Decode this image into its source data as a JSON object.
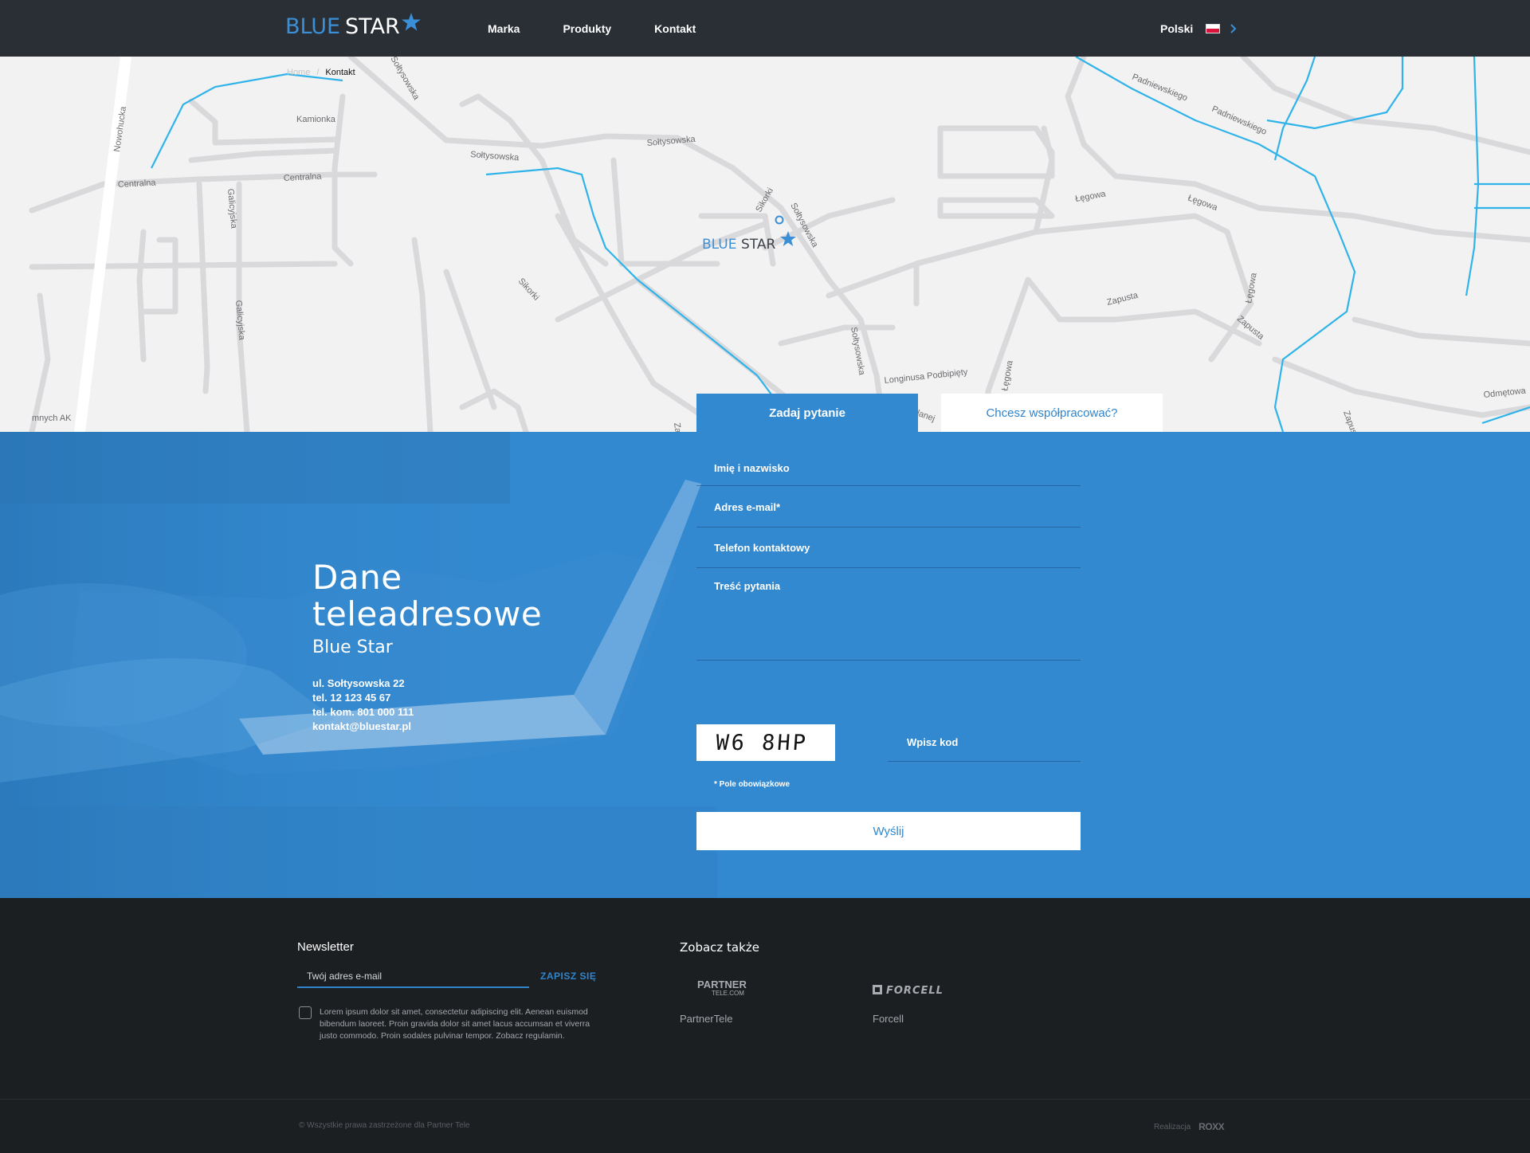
{
  "header": {
    "logo_blue": "BLUE",
    "logo_white": "STAR",
    "nav": [
      {
        "label": "Marka"
      },
      {
        "label": "Produkty"
      },
      {
        "label": "Kontakt"
      }
    ],
    "language": "Polski"
  },
  "breadcrumb": {
    "home": "Home",
    "separator": "/",
    "current": "Kontakt"
  },
  "map": {
    "streets": {
      "nowohucka": "Nowohucka",
      "kamionka": "Kamionka",
      "centralna1": "Centralna",
      "centralna2": "Centralna",
      "soltysowska1": "Sołtysowska",
      "soltysowska2": "Sołtysowska",
      "soltysowska3": "Sołtysowska",
      "soltysowska4": "Sołtysowska",
      "soltysowska5": "Sołtysowska",
      "galicyjska1": "Galicyjska",
      "galicyjska2": "Galicyjska",
      "sikorki1": "Sikorki",
      "sikorki2": "Sikorki",
      "legowa1": "Łęgowa",
      "legowa2": "Łęgowa",
      "legowa3": "Łęgowa",
      "legowa4": "Łęgowa",
      "padniewskiego1": "Padniewskiego",
      "padniewskiego2": "Padniewskiego",
      "zapusta1": "Zapusta",
      "zapusta2": "Zapusta",
      "zapusta3": "Zapusta",
      "longinusa": "Longinusa Podbipięty",
      "odmetowa": "Odmętowa",
      "mnych": "mnych AK",
      "zal": "Zał",
      "lanej": "lanej"
    },
    "marker_blue": "BLUE",
    "marker_white": "STAR"
  },
  "tabs": {
    "ask": "Zadaj pytanie",
    "cooperate": "Chcesz współpracować?"
  },
  "address": {
    "title_line1": "Dane",
    "title_line2": "teleadresowe",
    "company": "Blue Star",
    "street": "ul. Sołtysowska 22",
    "phone": "tel. 12 123 45 67",
    "mobile": "tel. kom. 801 000 111",
    "email": "kontakt@bluestar.pl"
  },
  "form": {
    "name_placeholder": "Imię i nazwisko",
    "email_placeholder": "Adres e-mail*",
    "phone_placeholder": "Telefon kontaktowy",
    "message_placeholder": "Treść pytania",
    "captcha_text": "W6 8HP",
    "captcha_placeholder": "Wpisz kod",
    "required_note": "* Pole obowiązkowe",
    "submit": "Wyślij"
  },
  "footer": {
    "newsletter_title": "Newsletter",
    "newsletter_placeholder": "Twój adres e-mail",
    "newsletter_button": "ZAPISZ SIĘ",
    "consent_text": "Lorem ipsum dolor sit amet, consectetur adipiscing elit. Aenean euismod bibendum laoreet. Proin gravida dolor sit amet lacus accumsan et viverra justo commodo. Proin sodales pulvinar tempor. Zobacz regulamin.",
    "see_also_title": "Zobacz także",
    "partner_logo_main": "PARTNER",
    "partner_logo_sub": "TELE.COM",
    "partner_name": "PartnerTele",
    "forcell_logo": "FORCELL",
    "forcell_name": "Forcell",
    "copyright": "© Wszystkie prawa zastrzeżone dla Partner Tele",
    "realization_label": "Realizacja",
    "realization_brand": "ROXX"
  },
  "colors": {
    "accent": "#3389cf",
    "header_bg": "#2a2f35",
    "footer_bg": "#1c1f22",
    "map_bg": "#f2f2f3",
    "map_road": "#d9d9dc",
    "map_water": "#2fb3e8"
  },
  "icons": {
    "logo_star": "star-icon",
    "lang_flag": "poland-flag-icon",
    "lang_arrow": "chevron-right-icon",
    "map_pin": "location-pin-icon",
    "checkbox": "checkbox-icon"
  }
}
